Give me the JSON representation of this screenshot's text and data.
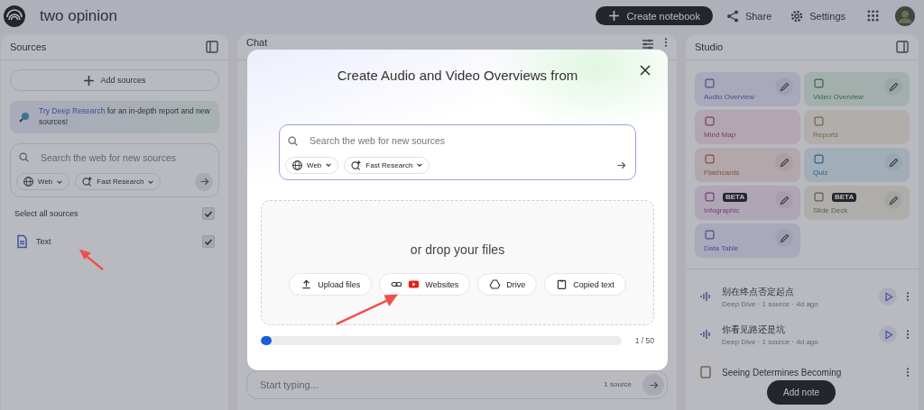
{
  "app": {
    "notebook_title": "two opinion",
    "create_button": "Create notebook",
    "share_button": "Share",
    "settings_button": "Settings"
  },
  "sources": {
    "title": "Sources",
    "add_button": "Add sources",
    "banner": {
      "link": "Try Deep Research",
      "text": "for an in-depth report and new sources!"
    },
    "search": {
      "placeholder": "Search the web for new sources",
      "source_chip": "Web",
      "mode_chip": "Fast Research"
    },
    "select_all": {
      "label": "Select all sources",
      "checked": true
    },
    "items": [
      {
        "name": "Text",
        "checked": true
      }
    ]
  },
  "chat": {
    "title": "Chat",
    "input": {
      "placeholder": "Start typing..."
    },
    "source_count": "1 source"
  },
  "studio": {
    "title": "Studio",
    "tiles": [
      {
        "kind": "audio",
        "label": "Audio Overview",
        "editable": true
      },
      {
        "kind": "video",
        "label": "Video Overview",
        "editable": true
      },
      {
        "kind": "mindmap",
        "label": "Mind Map",
        "editable": false
      },
      {
        "kind": "reports",
        "label": "Reports",
        "editable": false
      },
      {
        "kind": "flashcards",
        "label": "Flashcards",
        "editable": true
      },
      {
        "kind": "quiz",
        "label": "Quiz",
        "editable": true
      },
      {
        "kind": "infographic",
        "label": "Infographic",
        "editable": true,
        "badge": "BETA"
      },
      {
        "kind": "slides",
        "label": "Slide Deck",
        "editable": true,
        "badge": "BETA"
      },
      {
        "kind": "table",
        "label": "Data Table",
        "editable": true
      }
    ],
    "outputs": [
      {
        "kind": "audio",
        "title": "别在终点否定起点",
        "meta": "Deep Dive · 1 source · 4d ago"
      },
      {
        "kind": "audio",
        "title": "你看见路还是坑",
        "meta": "Deep Dive · 1 source · 4d ago"
      },
      {
        "kind": "report",
        "title": "Seeing Determines Becoming"
      }
    ],
    "add_note_button": "Add note"
  },
  "dialog": {
    "title": "Create Audio and Video Overviews from",
    "search": {
      "placeholder": "Search the web for new sources",
      "source_chip": "Web",
      "mode_chip": "Fast Research"
    },
    "drop_text": "or drop your files",
    "buttons": [
      {
        "kind": "upload",
        "label": "Upload files"
      },
      {
        "kind": "websites",
        "label": "Websites"
      },
      {
        "kind": "drive",
        "label": "Drive"
      },
      {
        "kind": "paste",
        "label": "Copied text"
      }
    ],
    "limit": {
      "level": 0.03,
      "reading": "1 / 50"
    }
  }
}
